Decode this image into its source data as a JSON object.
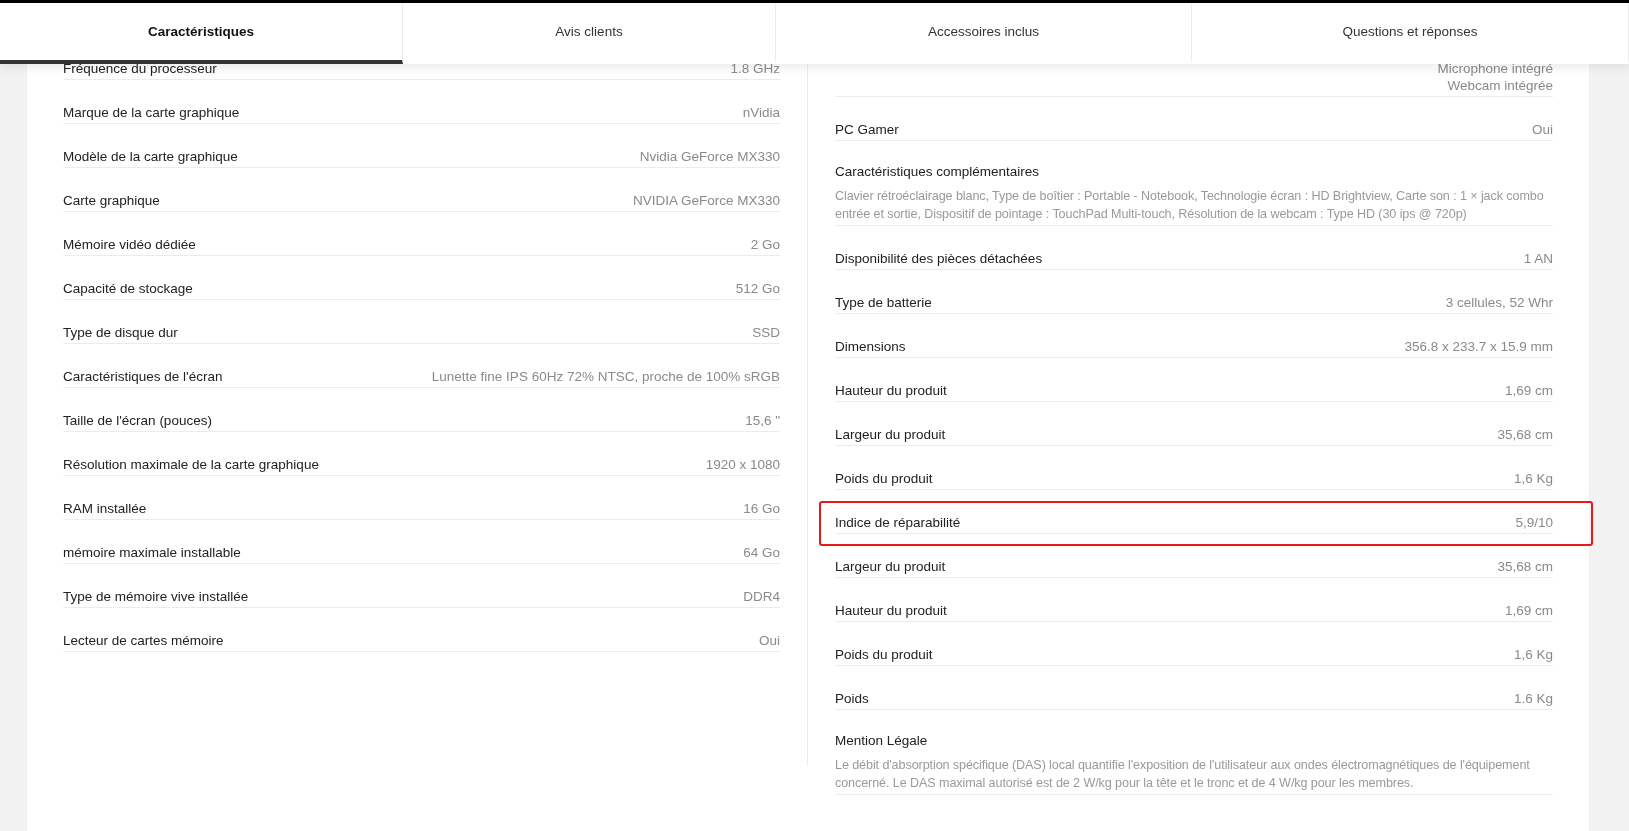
{
  "tabs": [
    {
      "label": "Caractéristiques",
      "selected": true
    },
    {
      "label": "Avis clients",
      "selected": false
    },
    {
      "label": "Accessoires inclus",
      "selected": false
    },
    {
      "label": "Questions et réponses",
      "selected": false
    }
  ],
  "left_column": {
    "rows": [
      {
        "kind": "pair",
        "label": "Fréquence du processeur",
        "value": "1.8 GHz",
        "highlighted": false
      },
      {
        "kind": "pair",
        "label": "Marque de la carte graphique",
        "value": "nVidia",
        "highlighted": false
      },
      {
        "kind": "pair",
        "label": "Modèle de la carte graphique",
        "value": "Nvidia GeForce MX330",
        "highlighted": false
      },
      {
        "kind": "pair",
        "label": "Carte graphique",
        "value": "NVIDIA GeForce MX330",
        "highlighted": false
      },
      {
        "kind": "pair",
        "label": "Mémoire vidéo dédiée",
        "value": "2 Go",
        "highlighted": false
      },
      {
        "kind": "pair",
        "label": "Capacité de stockage",
        "value": "512 Go",
        "highlighted": false
      },
      {
        "kind": "pair",
        "label": "Type de disque dur",
        "value": "SSD",
        "highlighted": false
      },
      {
        "kind": "pair",
        "label": "Caractéristiques de l'écran",
        "value": "Lunette fine IPS 60Hz 72% NTSC, proche de 100% sRGB",
        "highlighted": false
      },
      {
        "kind": "pair",
        "label": "Taille de l'écran (pouces)",
        "value": "15,6 \"",
        "highlighted": false
      },
      {
        "kind": "pair",
        "label": "Résolution maximale de la carte graphique",
        "value": "1920 x 1080",
        "highlighted": false
      },
      {
        "kind": "pair",
        "label": "RAM installée",
        "value": "16 Go",
        "highlighted": false
      },
      {
        "kind": "pair",
        "label": "mémoire maximale installable",
        "value": "64 Go",
        "highlighted": false
      },
      {
        "kind": "pair",
        "label": "Type de mémoire vive installée",
        "value": "DDR4",
        "highlighted": false
      },
      {
        "kind": "pair",
        "label": "Lecteur de cartes mémoire",
        "value": "Oui",
        "highlighted": false
      }
    ]
  },
  "right_column": {
    "rows": [
      {
        "kind": "values",
        "values": [
          "Microphone intégré",
          "Webcam intégrée"
        ],
        "highlighted": false
      },
      {
        "kind": "pair",
        "label": "PC Gamer",
        "value": "Oui",
        "highlighted": false
      },
      {
        "kind": "description",
        "label": "Caractéristiques complémentaires",
        "text": "Clavier rétroéclairage blanc, Type de boîtier : Portable - Notebook, Technologie écran : HD Brightview, Carte son : 1 × jack combo entrée et sortie, Dispositif de pointage : TouchPad Multi-touch, Résolution de la webcam : Type HD (30 ips @ 720p)",
        "highlighted": false
      },
      {
        "kind": "pair",
        "label": "Disponibilité des pièces détachées",
        "value": "1 AN",
        "highlighted": false
      },
      {
        "kind": "pair",
        "label": "Type de batterie",
        "value": "3 cellules, 52 Whr",
        "highlighted": false
      },
      {
        "kind": "pair",
        "label": "Dimensions",
        "value": "356.8 x 233.7 x 15.9 mm",
        "highlighted": false
      },
      {
        "kind": "pair",
        "label": "Hauteur du produit",
        "value": "1,69 cm",
        "highlighted": false
      },
      {
        "kind": "pair",
        "label": "Largeur du produit",
        "value": "35,68 cm",
        "highlighted": false
      },
      {
        "kind": "pair",
        "label": "Poids du produit",
        "value": "1,6 Kg",
        "highlighted": false
      },
      {
        "kind": "pair",
        "label": "Indice de réparabilité",
        "value": "5,9/10",
        "highlighted": true
      },
      {
        "kind": "pair",
        "label": "Largeur du produit",
        "value": "35,68 cm",
        "highlighted": false
      },
      {
        "kind": "pair",
        "label": "Hauteur du produit",
        "value": "1,69 cm",
        "highlighted": false
      },
      {
        "kind": "pair",
        "label": "Poids du produit",
        "value": "1,6 Kg",
        "highlighted": false
      },
      {
        "kind": "pair",
        "label": "Poids",
        "value": "1.6 Kg",
        "highlighted": false
      },
      {
        "kind": "description",
        "label": "Mention Légale",
        "text": "Le débit d'absorption spécifique (DAS) local quantifie l'exposition de l'utilisateur aux ondes électromagnétiques de l'équipement concerné. Le DAS maximal autorisé est de 2 W/kg pour la tête et le tronc et de 4 W/kg pour les membres.",
        "highlighted": false
      }
    ]
  }
}
